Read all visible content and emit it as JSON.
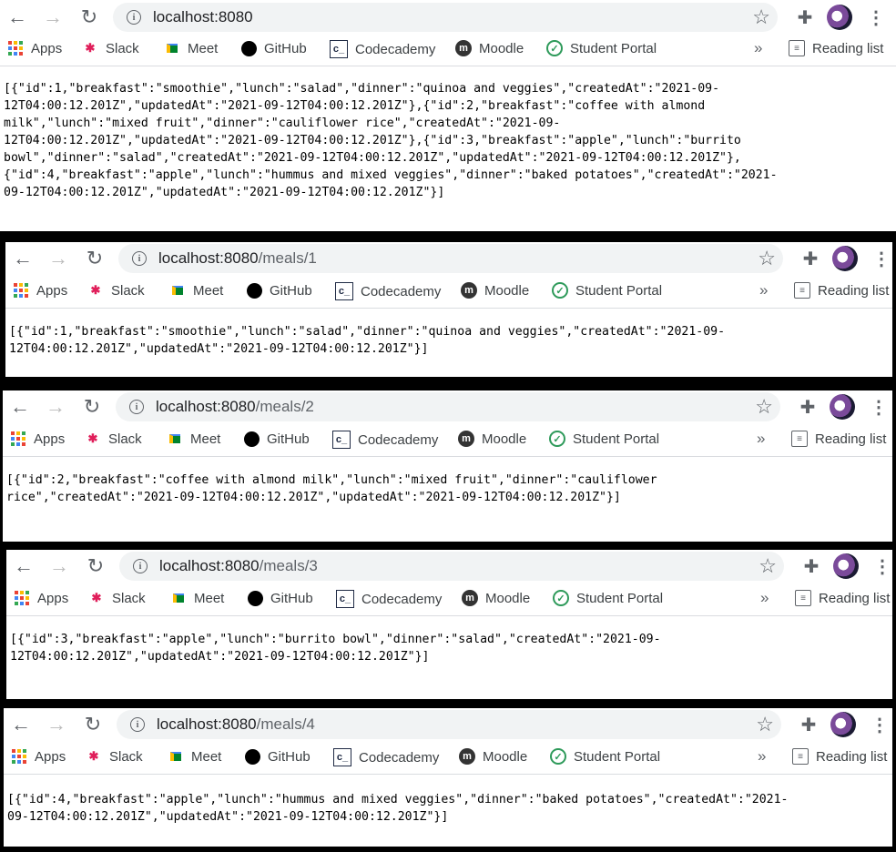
{
  "bookmarks": {
    "items": [
      {
        "label": "Apps"
      },
      {
        "label": "Slack"
      },
      {
        "label": "Meet"
      },
      {
        "label": "GitHub"
      },
      {
        "label": "Codecademy"
      },
      {
        "label": "Moodle"
      },
      {
        "label": "Student Portal"
      }
    ],
    "overflow": "»",
    "reading_list": "Reading list"
  },
  "windows": [
    {
      "host": "localhost:8080",
      "path": "",
      "body": "[{\"id\":1,\"breakfast\":\"smoothie\",\"lunch\":\"salad\",\"dinner\":\"quinoa and veggies\",\"createdAt\":\"2021-09-\n12T04:00:12.201Z\",\"updatedAt\":\"2021-09-12T04:00:12.201Z\"},{\"id\":2,\"breakfast\":\"coffee with almond\nmilk\",\"lunch\":\"mixed fruit\",\"dinner\":\"cauliflower rice\",\"createdAt\":\"2021-09-\n12T04:00:12.201Z\",\"updatedAt\":\"2021-09-12T04:00:12.201Z\"},{\"id\":3,\"breakfast\":\"apple\",\"lunch\":\"burrito\nbowl\",\"dinner\":\"salad\",\"createdAt\":\"2021-09-12T04:00:12.201Z\",\"updatedAt\":\"2021-09-12T04:00:12.201Z\"},\n{\"id\":4,\"breakfast\":\"apple\",\"lunch\":\"hummus and mixed veggies\",\"dinner\":\"baked potatoes\",\"createdAt\":\"2021-\n09-12T04:00:12.201Z\",\"updatedAt\":\"2021-09-12T04:00:12.201Z\"}]"
    },
    {
      "host": "localhost:8080",
      "path": "/meals/1",
      "body": "[{\"id\":1,\"breakfast\":\"smoothie\",\"lunch\":\"salad\",\"dinner\":\"quinoa and veggies\",\"createdAt\":\"2021-09-\n12T04:00:12.201Z\",\"updatedAt\":\"2021-09-12T04:00:12.201Z\"}]"
    },
    {
      "host": "localhost:8080",
      "path": "/meals/2",
      "body": "[{\"id\":2,\"breakfast\":\"coffee with almond milk\",\"lunch\":\"mixed fruit\",\"dinner\":\"cauliflower\nrice\",\"createdAt\":\"2021-09-12T04:00:12.201Z\",\"updatedAt\":\"2021-09-12T04:00:12.201Z\"}]"
    },
    {
      "host": "localhost:8080",
      "path": "/meals/3",
      "body": "[{\"id\":3,\"breakfast\":\"apple\",\"lunch\":\"burrito bowl\",\"dinner\":\"salad\",\"createdAt\":\"2021-09-\n12T04:00:12.201Z\",\"updatedAt\":\"2021-09-12T04:00:12.201Z\"}]"
    },
    {
      "host": "localhost:8080",
      "path": "/meals/4",
      "body": "[{\"id\":4,\"breakfast\":\"apple\",\"lunch\":\"hummus and mixed veggies\",\"dinner\":\"baked potatoes\",\"createdAt\":\"2021-\n09-12T04:00:12.201Z\",\"updatedAt\":\"2021-09-12T04:00:12.201Z\"}]"
    }
  ]
}
